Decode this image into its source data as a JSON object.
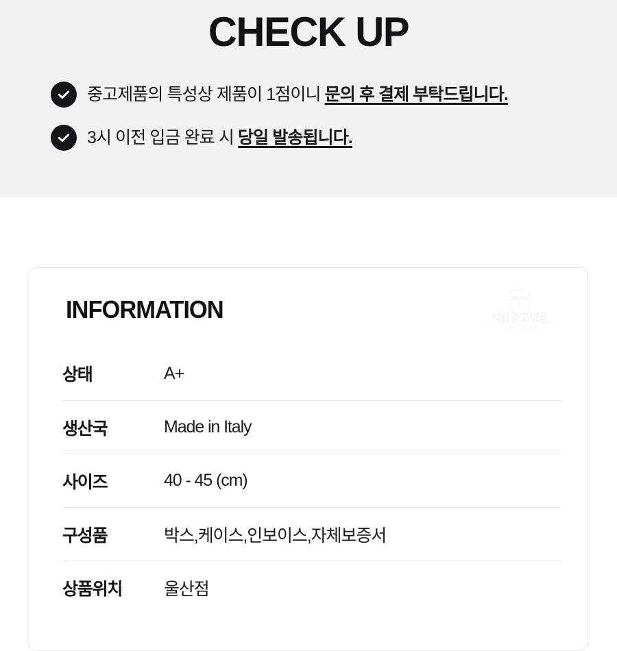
{
  "checkup": {
    "title": "CHECK UP",
    "items": [
      {
        "icon": "check-circle-icon",
        "text_plain": "중고제품의 특성상 제품이 1점이니 ",
        "text_emphasis": "문의 후 결제 부탁드립니다."
      },
      {
        "icon": "check-circle-icon",
        "text_plain": "3시 이전 입금 완료 시 ",
        "text_emphasis": "당일 발송됩니다."
      }
    ]
  },
  "information": {
    "title": "INFORMATION",
    "watermark": {
      "icon": "watch-icon",
      "brand": "착한중고명품",
      "subtitle": "LUXURY GOODS"
    },
    "rows": [
      {
        "label": "상태",
        "value": "A+"
      },
      {
        "label": "생산국",
        "value": "Made in Italy"
      },
      {
        "label": "사이즈",
        "value": "40 - 45 (cm)"
      },
      {
        "label": "구성품",
        "value": "박스,케이스,인보이스,자체보증서"
      },
      {
        "label": "상품위치",
        "value": "울산점"
      }
    ]
  },
  "colors": {
    "band_background": "#f1f2f4",
    "page_background": "#ffffff",
    "text_primary": "#111215",
    "icon_fill": "#16161a",
    "card_border": "#e3e4e6",
    "divider": "#e6e7e9",
    "watermark": "#d8dadd"
  }
}
